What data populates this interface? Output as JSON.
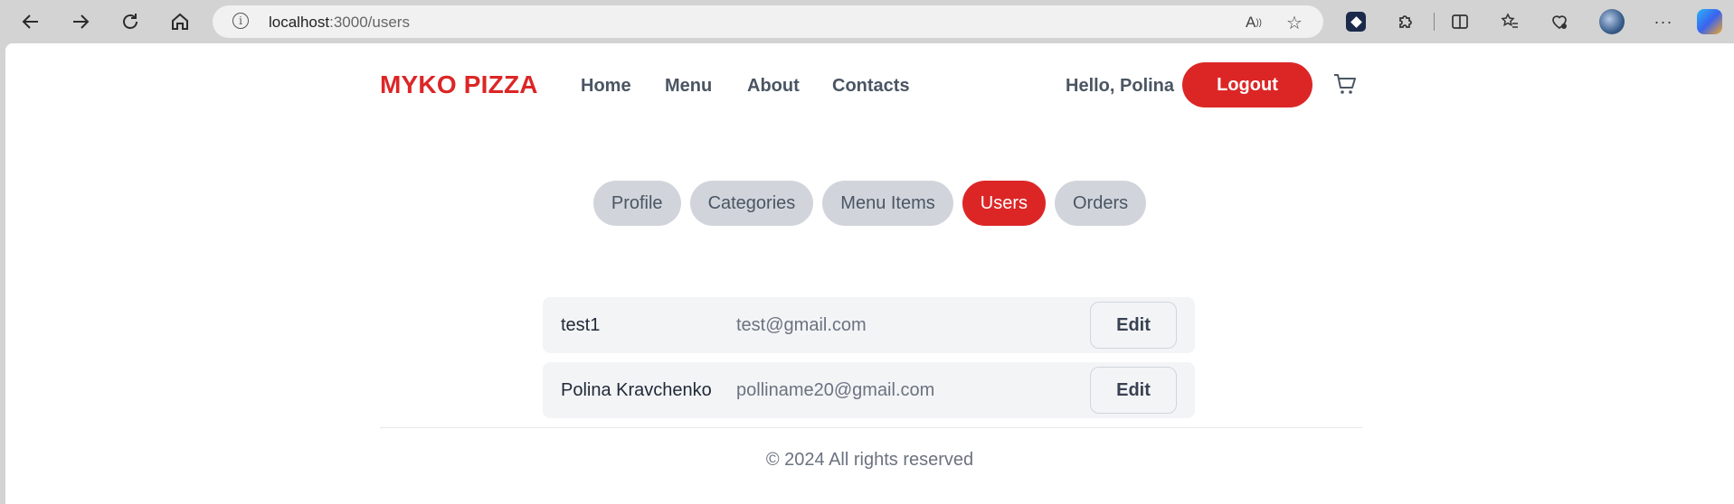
{
  "browser": {
    "url_host": "localhost",
    "url_path": ":3000/users"
  },
  "header": {
    "logo": "MYKO PIZZA",
    "nav": [
      "Home",
      "Menu",
      "About",
      "Contacts"
    ],
    "greeting": "Hello, Polina",
    "logout_label": "Logout"
  },
  "tabs": [
    {
      "label": "Profile",
      "active": false
    },
    {
      "label": "Categories",
      "active": false
    },
    {
      "label": "Menu Items",
      "active": false
    },
    {
      "label": "Users",
      "active": true
    },
    {
      "label": "Orders",
      "active": false
    }
  ],
  "users": [
    {
      "name": "test1",
      "email": "test@gmail.com",
      "action": "Edit"
    },
    {
      "name": "Polina Kravchenko",
      "email": "polliname20@gmail.com",
      "action": "Edit"
    }
  ],
  "footer": {
    "text": "© 2024 All rights reserved"
  },
  "colors": {
    "accent": "#dc2626",
    "tab_inactive": "#d1d5db",
    "row_background": "#f3f4f6"
  }
}
